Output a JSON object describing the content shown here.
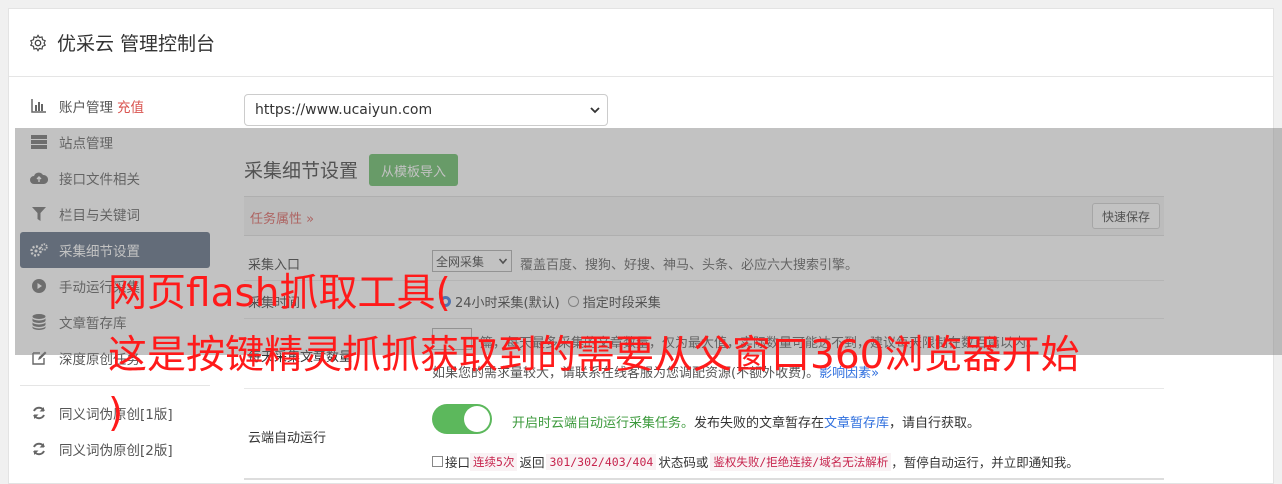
{
  "header": {
    "title": "优采云 管理控制台",
    "icon": "gear-icon"
  },
  "sidebar": {
    "items": [
      {
        "label": "账户管理",
        "extra": "充值",
        "icon": "bar-chart-icon"
      },
      {
        "label": "站点管理",
        "icon": "server-icon"
      },
      {
        "label": "接口文件相关",
        "icon": "cloud-upload-icon"
      },
      {
        "label": "栏目与关键词",
        "icon": "filter-icon"
      },
      {
        "label": "采集细节设置",
        "icon": "gears-icon",
        "active": true
      },
      {
        "label": "手动运行采集",
        "icon": "play-circle-icon"
      },
      {
        "label": "文章暂存库",
        "icon": "database-icon"
      },
      {
        "label": "深度原创任务",
        "icon": "edit-icon"
      }
    ],
    "items2": [
      {
        "label": "同义词伪原创[1版]",
        "icon": "refresh-icon"
      },
      {
        "label": "同义词伪原创[2版]",
        "icon": "refresh-icon"
      }
    ]
  },
  "main": {
    "site_select": "https://www.ucaiyun.com",
    "section_title": "采集细节设置",
    "import_button": "从模板导入",
    "task_attr": "任务属性 »",
    "save_button": "快速保存",
    "entry": {
      "label": "采集入口",
      "select_value": "全网采集",
      "desc": "覆盖百度、搜狗、好搜、神马、头条、必应六大搜索引擎。"
    },
    "time": {
      "label": "采集时间",
      "opt1": "24小时采集(默认)",
      "opt2": "指定时段采集"
    },
    "limit": {
      "label": "每天采集文章数量",
      "text": "篇，每天最多采集的文章数量，仅为最大值，实际数量可能达不到，建议每天限制在数百篇以内。",
      "text2_prefix": "如果您的需求量较大，请联系在线客服为您调配资源(不额外收费)。",
      "link": "影响因素»"
    },
    "cloud": {
      "label": "云端自动运行",
      "toggle_on": true,
      "desc_green": "开启时云端自动运行采集任务。",
      "desc_mid": "发布失败的文章暂存在",
      "desc_link": "文章暂存库",
      "desc_end": "，请自行获取。",
      "cb_prefix": "接口",
      "code1": "连续5次",
      "mid1": "返回",
      "code2": "301/302/403/404",
      "mid2": "状态码或",
      "code3": "鉴权失败/拒绝连接/域名无法解析",
      "tail": "，暂停自动运行，并立即通知我。"
    }
  },
  "watermark": {
    "line1": "网页flash抓取工具(",
    "line2": "这是按键精灵抓抓获取到的需要从父窗口360浏览器开始",
    "line3": ")"
  },
  "colors": {
    "accent_green": "#5cb85c",
    "active_nav": "#53637a",
    "danger": "#d9534f",
    "watermark": "#ff1a1a"
  }
}
